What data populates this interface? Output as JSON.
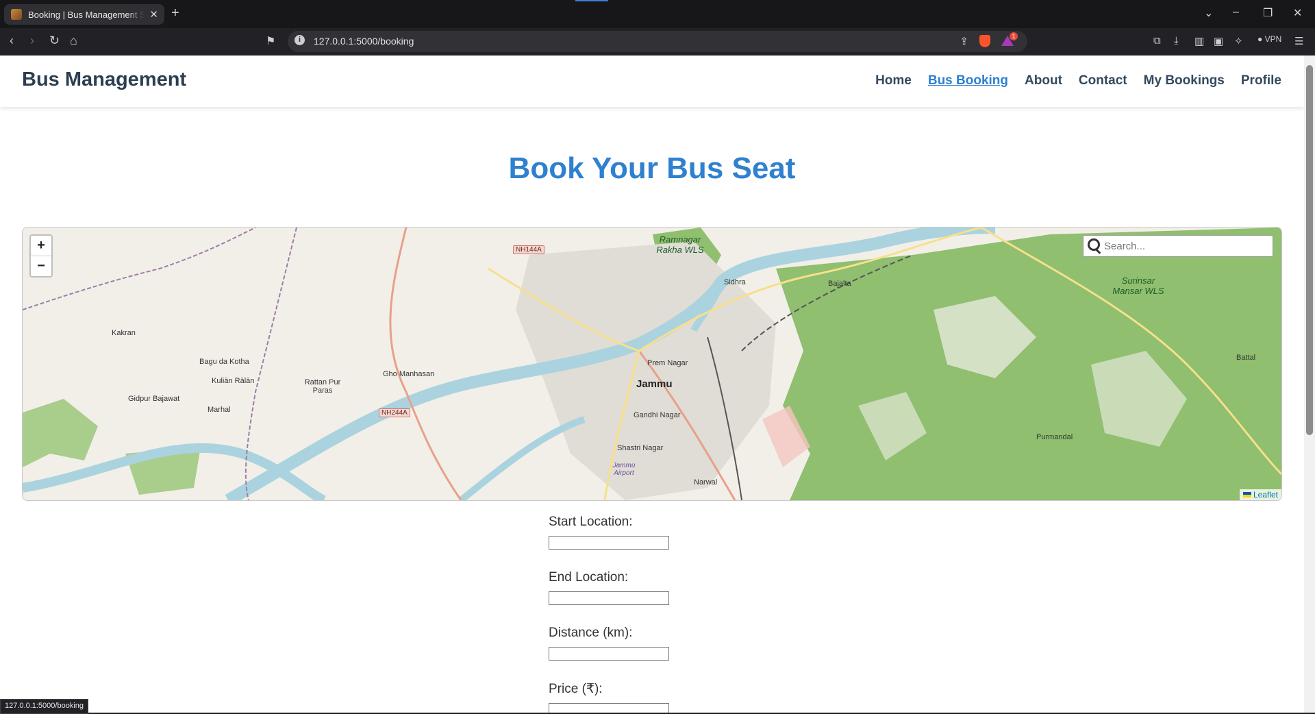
{
  "browser": {
    "tab_title": "Booking | Bus Management System",
    "url": "127.0.0.1:5000/booking",
    "vpn_label": "VPN",
    "rewards_count": "1",
    "status_url": "127.0.0.1:5000/booking"
  },
  "header": {
    "brand": "Bus Management",
    "nav": [
      "Home",
      "Bus Booking",
      "About",
      "Contact",
      "My Bookings",
      "Profile"
    ],
    "active_nav": "Bus Booking"
  },
  "main": {
    "title": "Book Your Bus Seat"
  },
  "map": {
    "search_placeholder": "Search...",
    "zoom_in": "+",
    "zoom_out": "−",
    "attribution": "Leaflet",
    "labels": {
      "jammu": "Jammu",
      "prem_nagar": "Prem Nagar",
      "gandhi_nagar": "Gandhi Nagar",
      "shastri_nagar": "Shastri Nagar",
      "narwal": "Narwal",
      "jammu_airport": "Jammu Airport",
      "sidhra": "Sidhra",
      "bajalta": "Bajalta",
      "ramnagar_wls": "Ramnagar Rakha WLS",
      "surinsar_wls": "Surinsar Mansar WLS",
      "battal": "Battal",
      "purmandal": "Purmandal",
      "nh144a": "NH144A",
      "nh244a": "NH244A",
      "gho_manhasan": "Gho Manhasan",
      "rattan_pur": "Rattan Pur Paras",
      "kulian_ralan": "Kuliān Rālān",
      "bagu_da_kotha": "Bagu da Kotha",
      "marhal": "Marhal",
      "gidpur": "Gidpur Bajawat",
      "kakran": "Kakran"
    }
  },
  "form": {
    "start_label": "Start Location:",
    "end_label": "End Location:",
    "distance_label": "Distance (km):",
    "price_label": "Price (₹):"
  },
  "colors": {
    "accent": "#2f80d0",
    "heading": "#2c3e50",
    "forest": "#8fbf6f",
    "water": "#aad3df"
  }
}
